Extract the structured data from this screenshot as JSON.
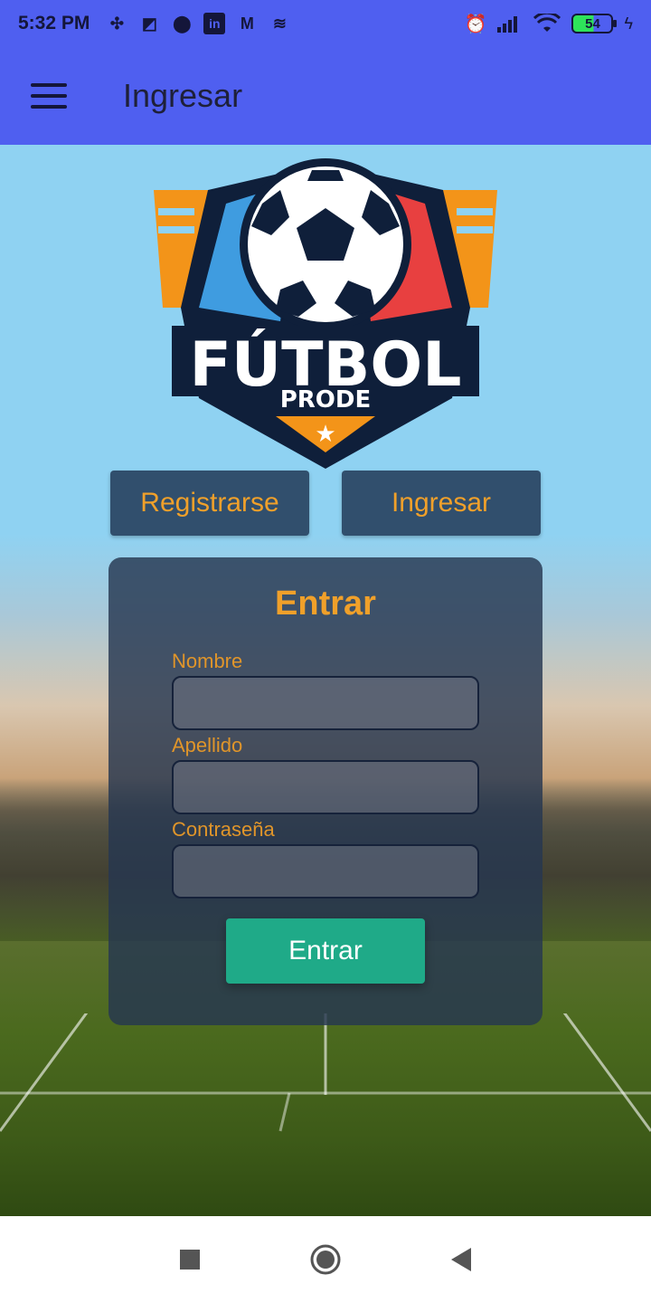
{
  "status_bar": {
    "time": "5:32 PM",
    "battery": "54",
    "left_icons": [
      "slack-icon",
      "app-icon",
      "arc-icon",
      "linkedin-icon",
      "gmail-icon",
      "stack-icon"
    ],
    "right_icons": [
      "alarm-icon",
      "signal-icon",
      "wifi-icon",
      "battery-icon",
      "charging-icon"
    ]
  },
  "app_bar": {
    "title": "Ingresar",
    "menu_icon": "hamburger-menu-icon"
  },
  "logo": {
    "main_text": "FÚTBOL",
    "sub_text": "PRODE"
  },
  "tabs": {
    "register": "Registrarse",
    "login": "Ingresar"
  },
  "form": {
    "title": "Entrar",
    "fields": [
      {
        "label": "Nombre",
        "value": ""
      },
      {
        "label": "Apellido",
        "value": ""
      },
      {
        "label": "Contraseña",
        "value": ""
      }
    ],
    "submit": "Entrar"
  },
  "nav_bar": {
    "icons": [
      "recents-square-icon",
      "home-circle-icon",
      "back-triangle-icon"
    ]
  },
  "colors": {
    "app_bar": "#4f5ff0",
    "accent_orange": "#f0a02a",
    "tab_button": "#314f6d",
    "submit_button": "#1faa88"
  }
}
